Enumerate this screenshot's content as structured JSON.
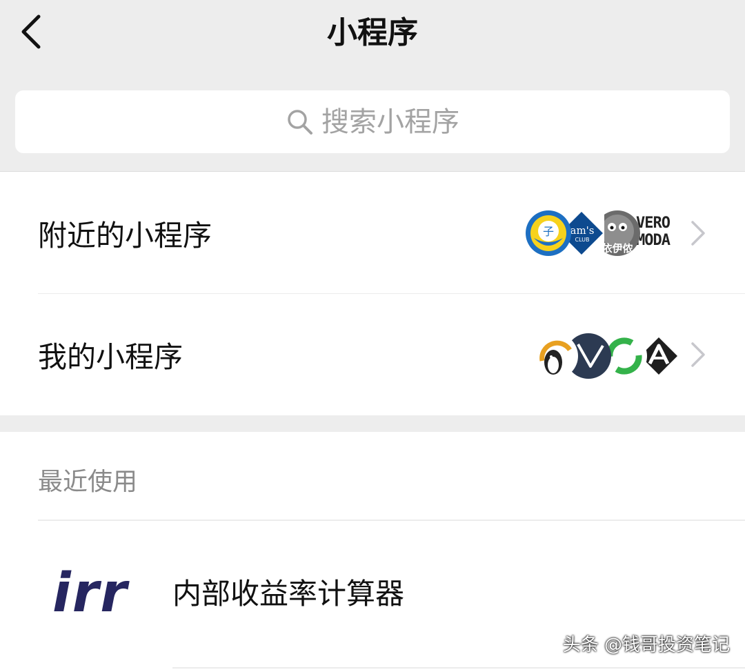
{
  "header": {
    "title": "小程序",
    "back_icon": "chevron-left-icon"
  },
  "search": {
    "placeholder": "搜索小程序",
    "icon": "search-icon"
  },
  "entries": {
    "nearby": {
      "label": "附近的小程序",
      "logos": [
        "child-emblem-logo",
        "sams-club-logo",
        "character-logo",
        "vero-moda-logo"
      ],
      "vero_line1": "VERO",
      "vero_line2": "MODA",
      "sams_text": "am's",
      "sams_club": "CLUB",
      "character_text": "依伊侬"
    },
    "mine": {
      "label": "我的小程序",
      "logos": [
        "penguin-logo",
        "triangle-arrow-logo",
        "green-recycle-logo",
        "triangle-a-logo"
      ]
    }
  },
  "recent": {
    "header": "最近使用",
    "items": [
      {
        "logo_text": "irr",
        "name": "内部收益率计算器"
      }
    ]
  },
  "watermark": "头条 @钱哥投资笔记",
  "colors": {
    "page_bg": "#ededed",
    "card_bg": "#ffffff",
    "placeholder": "#a3a3a3",
    "section_header": "#8a8a8a",
    "irr_logo": "#262660",
    "chevron": "#c7c7cc"
  }
}
